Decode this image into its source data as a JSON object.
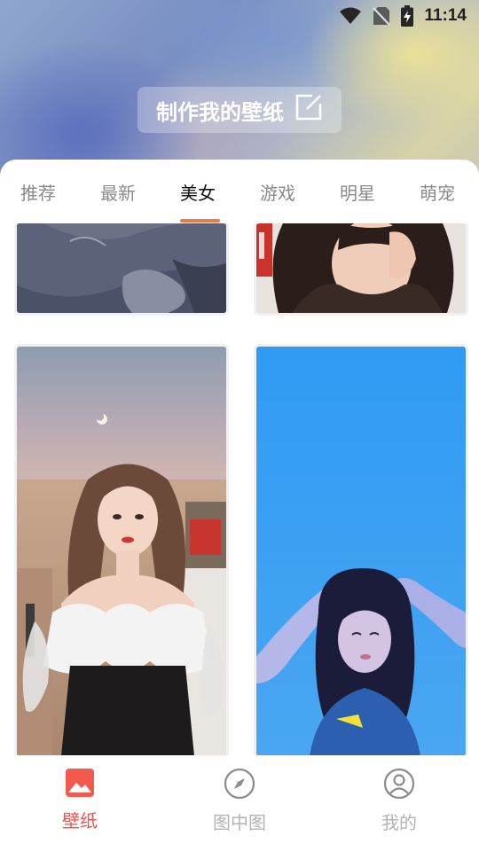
{
  "status_bar": {
    "time": "11:14",
    "icons": [
      "wifi-icon",
      "no-sim-icon",
      "battery-charging-icon"
    ]
  },
  "header": {
    "make_button_label": "制作我的壁纸",
    "make_button_icon": "edit-icon"
  },
  "tabs": [
    {
      "label": "推荐",
      "active": false
    },
    {
      "label": "最新",
      "active": false
    },
    {
      "label": "美女",
      "active": true
    },
    {
      "label": "游戏",
      "active": false
    },
    {
      "label": "明星",
      "active": false
    },
    {
      "label": "萌宠",
      "active": false
    }
  ],
  "wallpapers": [
    {
      "name": "wallpaper-anime-girl"
    },
    {
      "name": "wallpaper-curly-hair-girl"
    },
    {
      "name": "wallpaper-beach-girl"
    },
    {
      "name": "wallpaper-blue-girl"
    }
  ],
  "bottom_nav": [
    {
      "label": "壁纸",
      "icon": "image-icon",
      "active": true
    },
    {
      "label": "图中图",
      "icon": "compass-icon",
      "active": false
    },
    {
      "label": "我的",
      "icon": "user-icon",
      "active": false
    }
  ],
  "colors": {
    "accent": "#f07a45",
    "nav_active": "#f0514a",
    "nav_inactive": "#b3b3b3",
    "tab_inactive": "#8a8a8a"
  }
}
